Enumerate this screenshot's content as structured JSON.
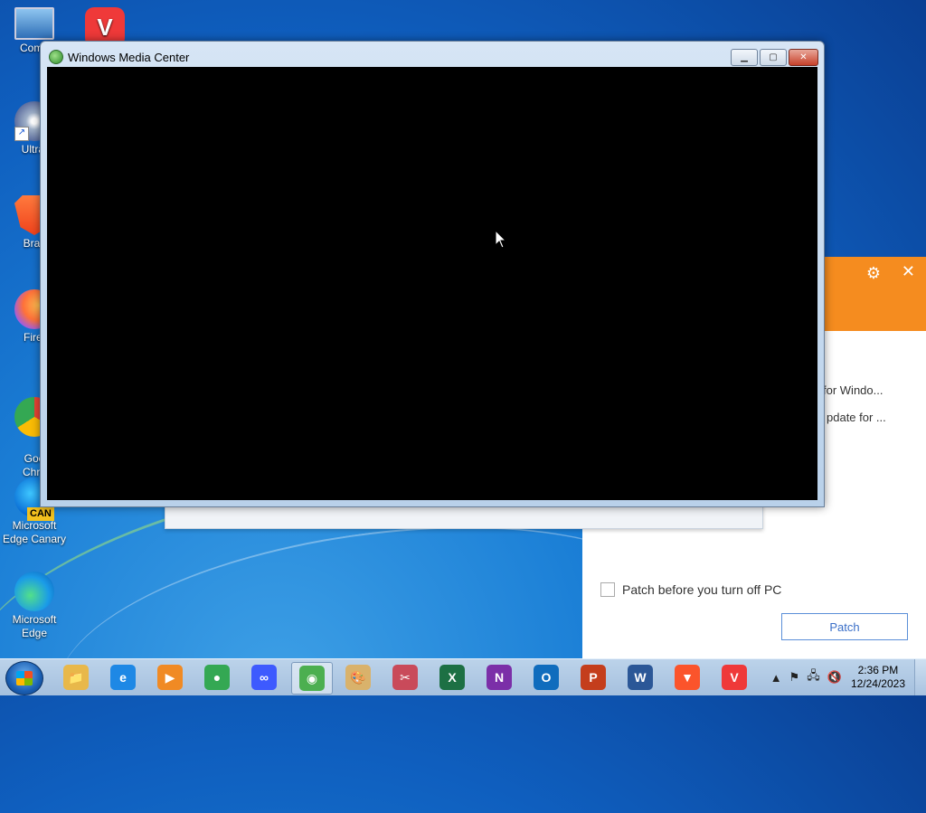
{
  "desktop": {
    "icons": [
      {
        "label": "Comp",
        "icon": "computer-icon"
      },
      {
        "label": "",
        "icon": "vivaldi-icon"
      },
      {
        "label": "UltraI",
        "icon": "ultraiso-icon"
      },
      {
        "label": "Brav",
        "icon": "brave-icon"
      },
      {
        "label": "Firef",
        "icon": "firefox-icon"
      },
      {
        "label": "Goo\nChro",
        "icon": "chrome-icon"
      },
      {
        "label": "Microsoft Edge Canary",
        "icon": "edge-canary-icon",
        "badge": "CAN"
      },
      {
        "label": "Microsoft Edge",
        "icon": "edge-icon"
      }
    ]
  },
  "window": {
    "title": "Windows Media Center",
    "minimize": "▁",
    "maximize": "▢",
    "close": "✕"
  },
  "patch_dialog": {
    "line1": "for Windo...",
    "line2": "pdate for ...",
    "checkbox_label": "Patch before you turn off PC",
    "button_label": "Patch",
    "gear": "⚙",
    "close": "✕"
  },
  "taskbar": {
    "items": [
      {
        "name": "explorer",
        "glyph": "📁",
        "color": "#e8b84a"
      },
      {
        "name": "internet-explorer",
        "glyph": "e",
        "color": "#1e88e5"
      },
      {
        "name": "media-player",
        "glyph": "▶",
        "color": "#f08a24"
      },
      {
        "name": "chrome",
        "glyph": "●",
        "color": "#34a853"
      },
      {
        "name": "infinity-app",
        "glyph": "∞",
        "color": "#3d5afe"
      },
      {
        "name": "media-center",
        "glyph": "◉",
        "color": "#4caf50",
        "active": true
      },
      {
        "name": "paint",
        "glyph": "🎨",
        "color": "#d9b26b"
      },
      {
        "name": "snipping-tool",
        "glyph": "✂",
        "color": "#c94a5a"
      },
      {
        "name": "excel",
        "glyph": "X",
        "color": "#1d7044"
      },
      {
        "name": "onenote",
        "glyph": "N",
        "color": "#7b2fa8"
      },
      {
        "name": "outlook",
        "glyph": "O",
        "color": "#0f6cbd"
      },
      {
        "name": "powerpoint",
        "glyph": "P",
        "color": "#c43e1c"
      },
      {
        "name": "word",
        "glyph": "W",
        "color": "#2b5797"
      },
      {
        "name": "brave",
        "glyph": "▼",
        "color": "#fb542b"
      },
      {
        "name": "vivaldi",
        "glyph": "V",
        "color": "#ef3939"
      }
    ],
    "tray": {
      "arrow": "▲",
      "time": "2:36 PM",
      "date": "12/24/2023"
    }
  }
}
